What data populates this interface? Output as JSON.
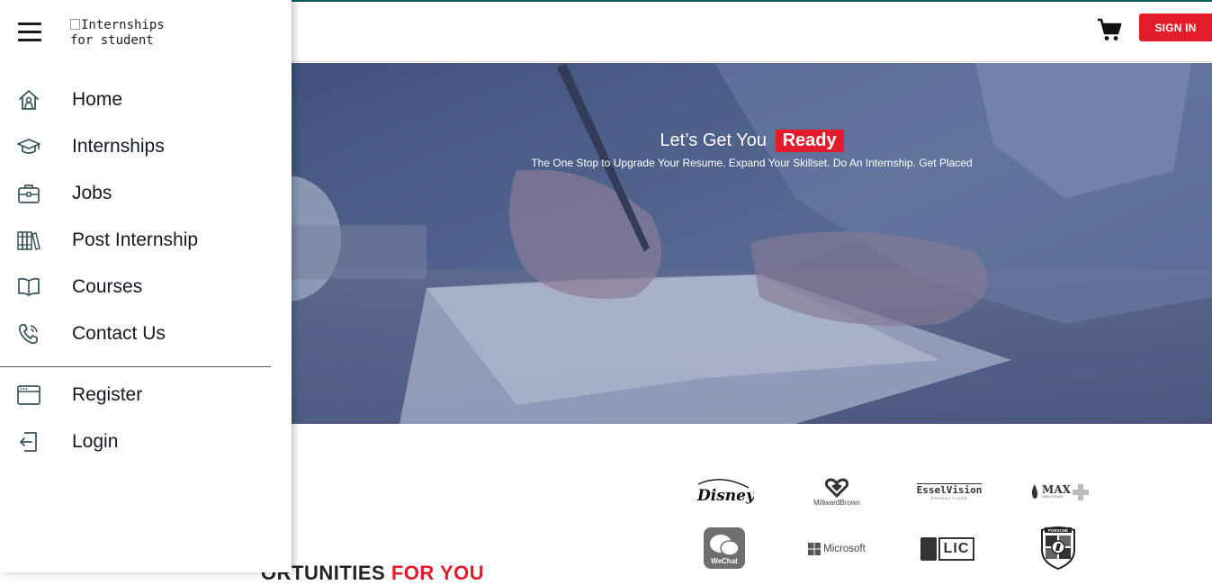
{
  "header": {
    "cart_icon": "shopping-cart-icon",
    "signin_label": "SIGN IN"
  },
  "hero": {
    "title_prefix": "Let’s Get You",
    "title_highlight": "Ready",
    "subtitle": "The One Stop to Upgrade Your Resume. Expand Your Skillset. Do An Internship. Get Placed"
  },
  "drawer": {
    "brand_alt_line1": "Internships",
    "brand_alt_line2": "for student",
    "menu_icon": "hamburger-icon",
    "primary_items": [
      {
        "label": "Home",
        "icon": "home-icon"
      },
      {
        "label": "Internships",
        "icon": "graduation-cap-icon"
      },
      {
        "label": "Jobs",
        "icon": "briefcase-icon"
      },
      {
        "label": "Post Internship",
        "icon": "books-icon"
      },
      {
        "label": "Courses",
        "icon": "open-book-icon"
      },
      {
        "label": "Contact Us",
        "icon": "phone-icon"
      }
    ],
    "account_items": [
      {
        "label": "Register",
        "icon": "browser-window-icon"
      },
      {
        "label": "Login",
        "icon": "login-icon"
      }
    ]
  },
  "section": {
    "title_visible": "ORTUNITIES",
    "title_red": "FOR YOU"
  },
  "logos": {
    "disney": "Disney",
    "millward": "MillwardBrown",
    "essel": "EsselVision",
    "essel_sub": "PRODUCTIONS",
    "max": "MAX",
    "max_sub": "HEALTHCARE",
    "wechat": "WeChat",
    "microsoft": "Microsoft",
    "lic": "LIC",
    "porsche": "PORSCHE"
  },
  "colors": {
    "accent_red": "#e31b2b",
    "top_line": "#0f5a55",
    "icon_color": "#37535a",
    "hero_overlay": "#4d5f8c"
  }
}
